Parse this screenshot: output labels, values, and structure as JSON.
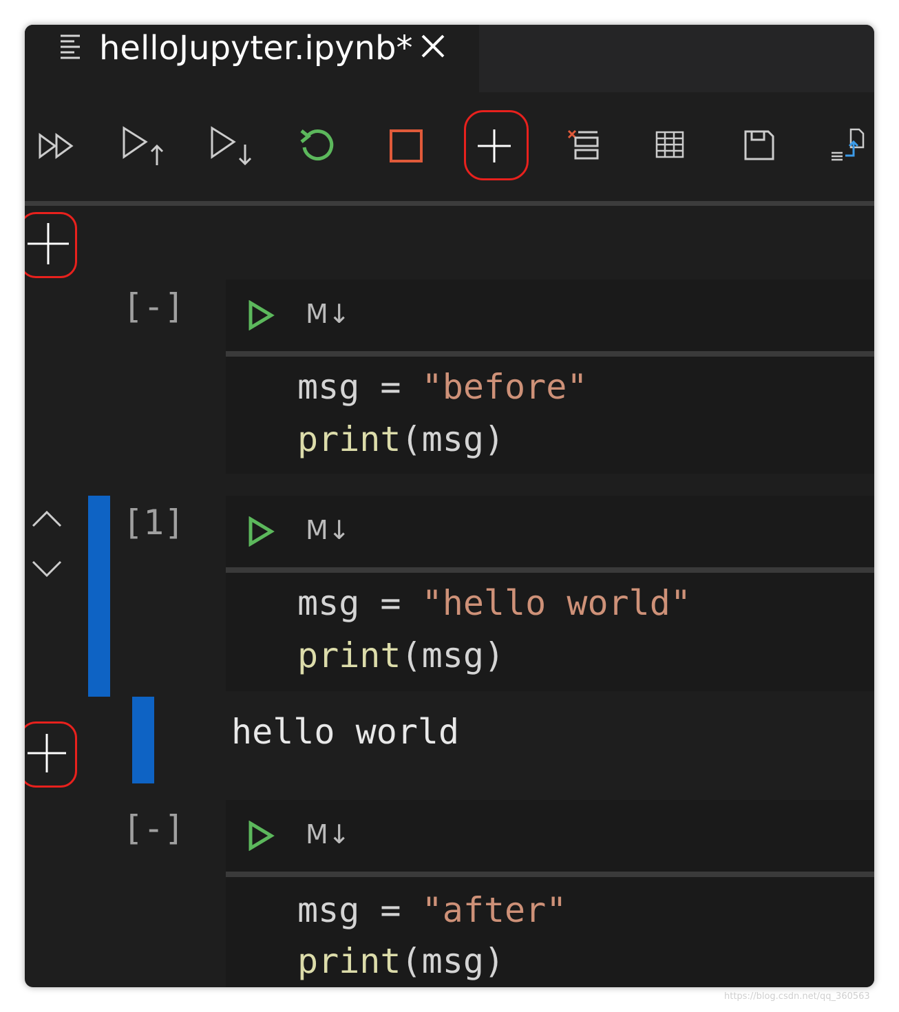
{
  "tab": {
    "title": "helloJupyter.ipynb*"
  },
  "toolbar": {
    "buttons": [
      "run-all",
      "run-above",
      "run-below",
      "restart-kernel",
      "interrupt-kernel",
      "add-cell",
      "clear-outputs",
      "variables",
      "save",
      "export"
    ]
  },
  "colors": {
    "accent_blue": "#0e63c4",
    "highlight_red": "#e8211d",
    "run_green": "#5cb85c",
    "string": "#ce9178",
    "function": "#dcdcaa"
  },
  "cells": [
    {
      "exec_count": "[-]",
      "lang_label": "M↓",
      "line1_var": "msg",
      "line1_op": " = ",
      "line1_str": "\"before\"",
      "line2_fn": "print",
      "line2_args": "(msg)"
    },
    {
      "exec_count": "[1]",
      "lang_label": "M↓",
      "line1_var": "msg",
      "line1_op": " = ",
      "line1_str": "\"hello world\"",
      "line2_fn": "print",
      "line2_args": "(msg)",
      "output": "hello world"
    },
    {
      "exec_count": "[-]",
      "lang_label": "M↓",
      "line1_var": "msg",
      "line1_op": " = ",
      "line1_str": "\"after\"",
      "line2_fn": "print",
      "line2_args": "(msg)"
    }
  ],
  "watermark": "https://blog.csdn.net/qq_360563"
}
